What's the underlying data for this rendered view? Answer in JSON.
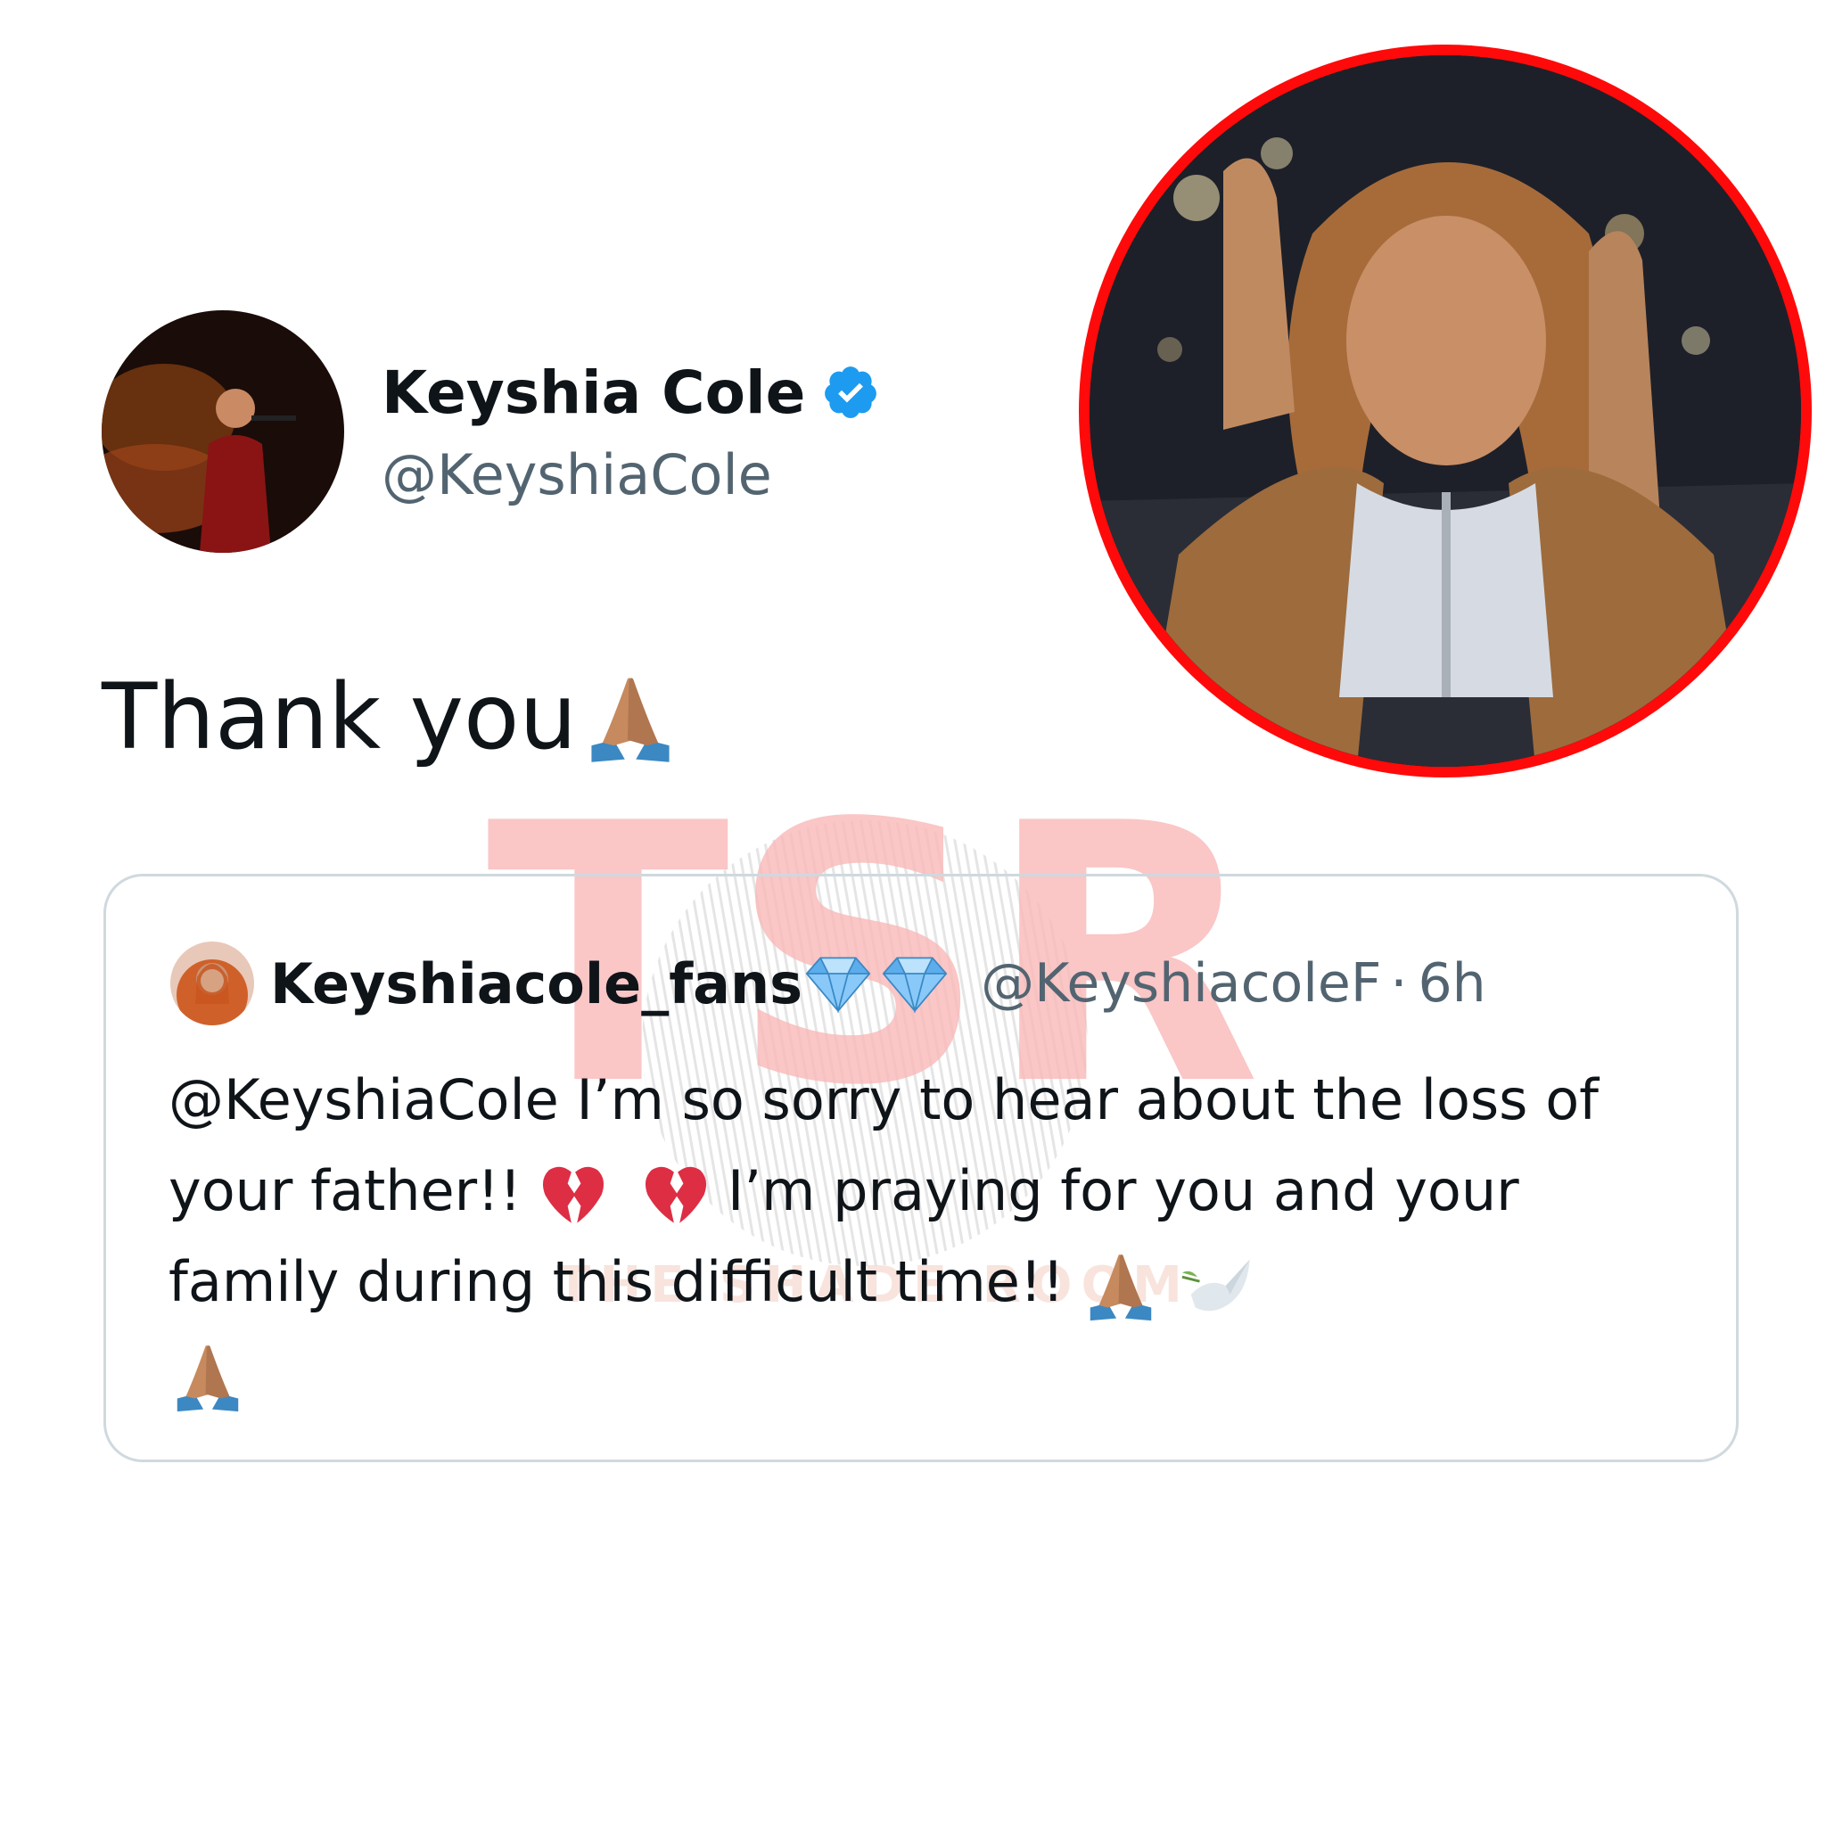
{
  "author": {
    "display_name": "Keyshia Cole",
    "handle": "@KeyshiaCole"
  },
  "tweet": {
    "text": "Thank you"
  },
  "quoted_tweet": {
    "display_name": "Keyshiacole_fans",
    "handle": "@KeyshiacoleF",
    "separator": "·",
    "time": "6h",
    "text_part1": "@KeyshiaCole I’m so sorry to hear about the loss of your father!!",
    "text_part2": " I’m praying for you and your family during this difficult time!!"
  },
  "watermark": {
    "letters": "TSR",
    "caption": "THE SHADE ROOM"
  },
  "colors": {
    "verified_blue": "#1d9bf0",
    "ring_red": "#ff0a0a",
    "watermark_pink": "#f9b9b9",
    "muted_text": "#536471",
    "border": "#cfd9de"
  },
  "icons": [
    "verified-badge-icon",
    "folded-hands-emoji",
    "gem-emoji",
    "broken-heart-emoji",
    "dove-emoji"
  ]
}
